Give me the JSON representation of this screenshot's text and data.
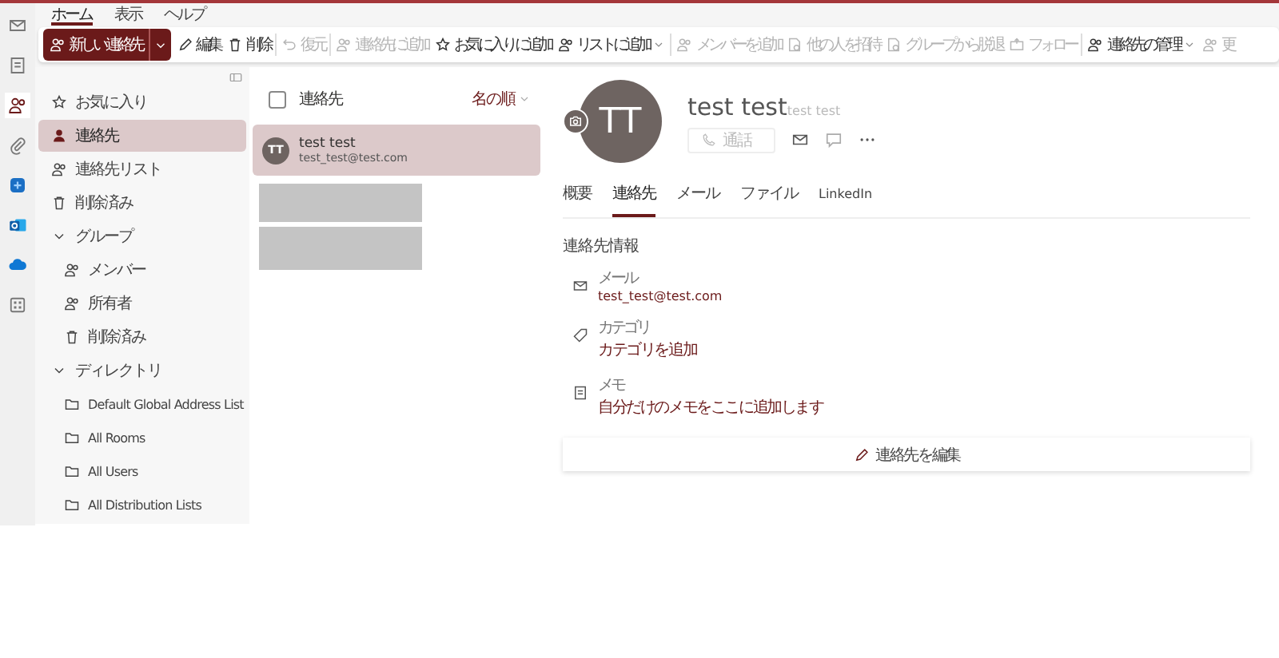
{
  "menu_tabs": [
    {
      "label": "ホーム",
      "selected": true
    },
    {
      "label": "表示",
      "selected": false
    },
    {
      "label": "ヘルプ",
      "selected": false
    }
  ],
  "toolbar": [
    {
      "label": "新しい連絡先",
      "kind": "primary",
      "disabled": false
    },
    {
      "label": "編集",
      "kind": "edit",
      "disabled": false
    },
    {
      "label": "削除",
      "kind": "trash",
      "disabled": false
    },
    {
      "label": "復元",
      "kind": "undo",
      "disabled": true
    },
    {
      "label": "連絡先に追加",
      "kind": "person-add",
      "disabled": true
    },
    {
      "label": "お気に入りに追加",
      "kind": "star-add",
      "disabled": false
    },
    {
      "label": "リストに追加",
      "kind": "people-menu",
      "disabled": false
    },
    {
      "label": "メンバーを追加",
      "kind": "person-add",
      "disabled": true
    },
    {
      "label": "他の人を招待",
      "kind": "doc",
      "disabled": true
    },
    {
      "label": "グループから脱退",
      "kind": "doc",
      "disabled": true
    },
    {
      "label": "フォロー",
      "kind": "follow",
      "disabled": true
    },
    {
      "label": "連絡先の管理",
      "kind": "people-menu",
      "disabled": false
    },
    {
      "label": "更",
      "kind": "person-add",
      "disabled": true
    }
  ],
  "app_rail": [
    {
      "kind": "mail",
      "selected": false
    },
    {
      "kind": "note",
      "selected": false
    },
    {
      "kind": "people",
      "selected": true
    },
    {
      "kind": "clip",
      "selected": false
    },
    {
      "kind": "tile-blue",
      "selected": false
    },
    {
      "kind": "tile-outlook",
      "selected": false
    },
    {
      "kind": "cloud",
      "selected": false
    },
    {
      "kind": "grid",
      "selected": false
    }
  ],
  "sidebar": {
    "items": [
      {
        "label": "お気に入り",
        "kind": "star",
        "selected": false
      },
      {
        "label": "連絡先",
        "kind": "person",
        "selected": true
      },
      {
        "label": "連絡先リスト",
        "kind": "people",
        "selected": false
      },
      {
        "label": "削除済み",
        "kind": "trash",
        "selected": false
      },
      {
        "label": "グループ",
        "kind": "group",
        "expanded": true,
        "children": [
          {
            "label": "メンバー",
            "kind": "people",
            "selected": false
          },
          {
            "label": "所有者",
            "kind": "people",
            "selected": false
          },
          {
            "label": "削除済み",
            "kind": "trash",
            "selected": false
          }
        ]
      },
      {
        "label": "ディレクトリ",
        "kind": "group",
        "expanded": true,
        "children": [
          {
            "label": "Default Global Address List",
            "kind": "folder",
            "selected": false
          },
          {
            "label": "All Rooms",
            "kind": "folder",
            "selected": false
          },
          {
            "label": "All Users",
            "kind": "folder",
            "selected": false
          },
          {
            "label": "All Distribution Lists",
            "kind": "folder",
            "selected": false
          }
        ]
      }
    ]
  },
  "contact_list": {
    "header": "連絡先",
    "sort": "名の順",
    "checked": false,
    "contacts": [
      {
        "initials": "TT",
        "name": "test test",
        "email": "test_test@test.com",
        "selected": true
      }
    ]
  },
  "detail": {
    "initials": "TT",
    "name": "test test",
    "phonetic": "test test",
    "call_button": "通話",
    "tabs": [
      {
        "label": "概要",
        "selected": false
      },
      {
        "label": "連絡先",
        "selected": true
      },
      {
        "label": "メール",
        "selected": false
      },
      {
        "label": "ファイル",
        "selected": false
      },
      {
        "label": "LinkedIn",
        "selected": false
      }
    ],
    "section_title": "連絡先情報",
    "fields": [
      {
        "kind": "mail",
        "label": "メール",
        "value": "test_test@test.com"
      },
      {
        "kind": "tag",
        "label": "カテゴリ",
        "value": "カテゴリを追加"
      },
      {
        "kind": "note",
        "label": "メモ",
        "value": "自分だけのメモをここに追加します"
      }
    ],
    "edit_button": "連絡先を編集"
  }
}
